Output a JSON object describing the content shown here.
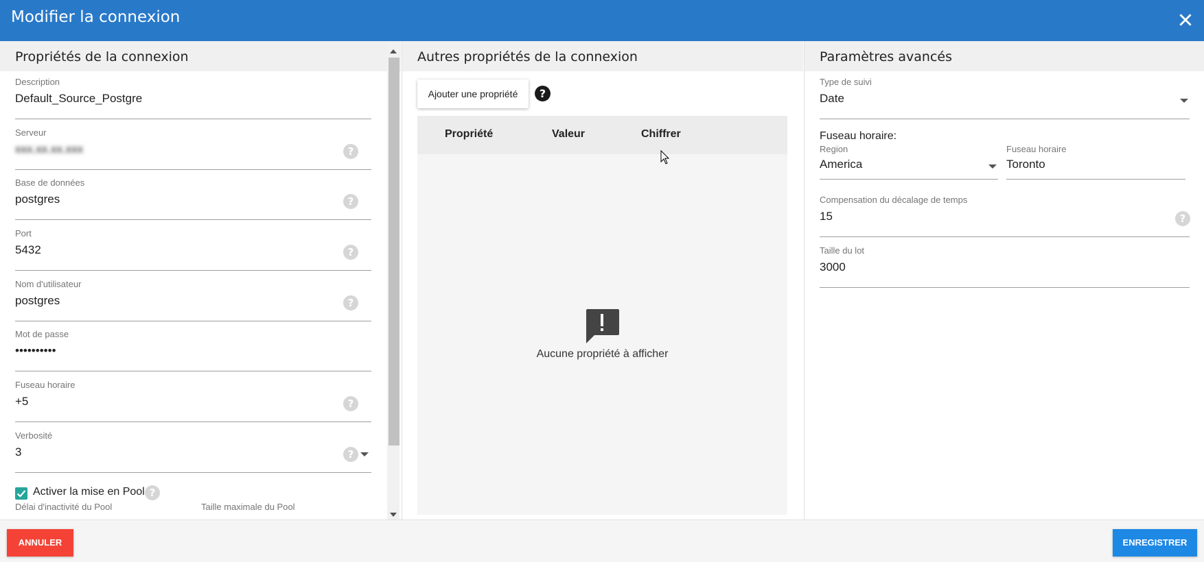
{
  "dialog": {
    "title": "Modifier la connexion"
  },
  "left": {
    "heading": "Propriétés de la connexion",
    "fields": [
      {
        "label": "Description",
        "value": "Default_Source_Postgre"
      },
      {
        "label": "Serveur",
        "value": "xxx.xx.xx.xxx"
      },
      {
        "label": "Base de données",
        "value": "postgres"
      },
      {
        "label": "Port",
        "value": "5432"
      },
      {
        "label": "Nom d'utilisateur",
        "value": "postgres"
      },
      {
        "label": "Mot de passe",
        "value": "••••••••••"
      },
      {
        "label": "Fuseau horaire",
        "value": "+5"
      },
      {
        "label": "Verbosité",
        "value": "3"
      }
    ],
    "pool": {
      "checkbox_label": "Activer la mise en Pool",
      "checked": true,
      "idle_label": "Délai d'inactivité du Pool",
      "max_label": "Taille maximale du Pool"
    }
  },
  "middle": {
    "heading": "Autres propriétés de la connexion",
    "add_button": "Ajouter une propriété",
    "columns": [
      "Propriété",
      "Valeur",
      "Chiffrer"
    ],
    "empty_message": "Aucune propriété à afficher"
  },
  "right": {
    "heading": "Paramètres avancés",
    "tracking_label": "Type de suivi",
    "tracking_value": "Date",
    "timezone_title": "Fuseau horaire:",
    "region_label": "Region",
    "region_value": "America",
    "tz_label": "Fuseau horaire",
    "tz_value": "Toronto",
    "offset_label": "Compensation du décalage de temps",
    "offset_value": "15",
    "batch_label": "Taille du lot",
    "batch_value": "3000"
  },
  "footer": {
    "cancel": "ANNULER",
    "save": "ENREGISTRER"
  },
  "colors": {
    "header": "#2979c9",
    "cancel": "#f44336",
    "save": "#1e88e5",
    "checkbox": "#26a69a"
  },
  "icons": [
    "close-icon",
    "help-icon",
    "dropdown-caret-icon",
    "alert-message-icon",
    "checkmark-icon"
  ]
}
